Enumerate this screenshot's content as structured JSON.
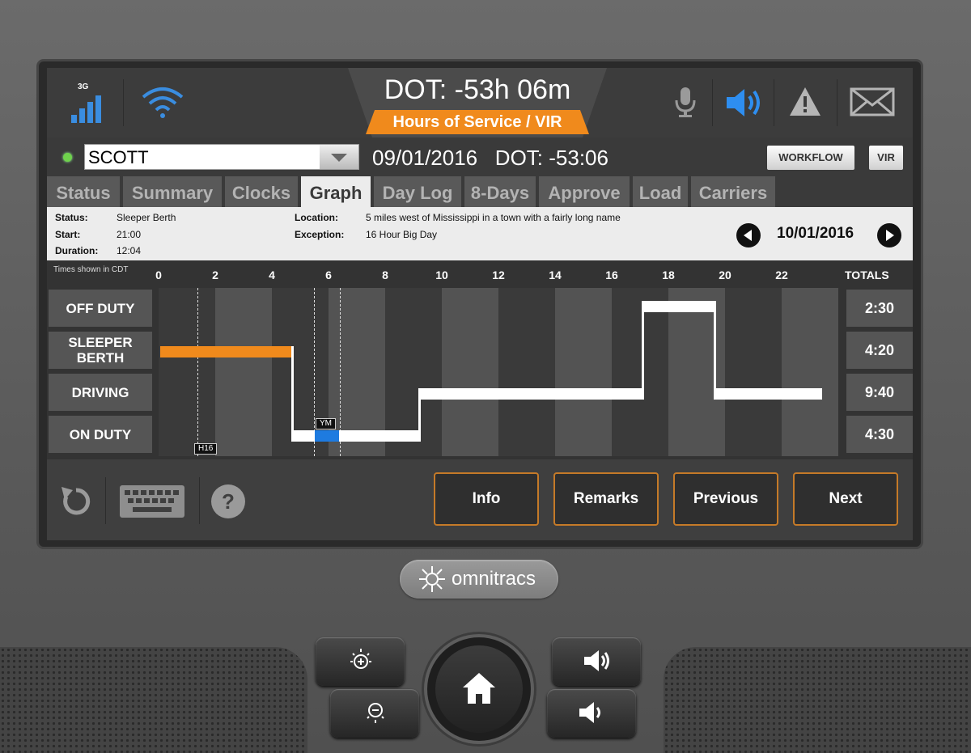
{
  "topbar": {
    "signal_label": "3G",
    "dot_clock": "DOT: -53h 06m",
    "subtitle": "Hours of Service / VIR"
  },
  "driver_row": {
    "driver_name": "SCOTT",
    "date_and_dot": "09/01/2016   DOT: -53:06",
    "workflow_label": "WORKFLOW",
    "vir_label": "VIR"
  },
  "tabs": [
    "Status",
    "Summary",
    "Clocks",
    "Graph",
    "Day Log",
    "8-Days",
    "Approve",
    "Load",
    "Carriers"
  ],
  "active_tab": "Graph",
  "info": {
    "status_key": "Status:",
    "status_val": "Sleeper Berth",
    "start_key": "Start:",
    "start_val": "21:00",
    "duration_key": "Duration:",
    "duration_val": "12:04",
    "location_key": "Location:",
    "location_val": "5 miles west of Mississippi in a town with a fairly long name",
    "exception_key": "Exception:",
    "exception_val": "16 Hour Big Day",
    "nav_date": "10/01/2016"
  },
  "graph": {
    "timezone_note": "Times shown in CDT",
    "hours": [
      "0",
      "2",
      "4",
      "6",
      "8",
      "10",
      "12",
      "14",
      "16",
      "18",
      "20",
      "22"
    ],
    "totals_header": "TOTALS",
    "rows": [
      {
        "label": "OFF DUTY",
        "total": "2:30"
      },
      {
        "label": "SLEEPER BERTH",
        "total": "4:20"
      },
      {
        "label": "DRIVING",
        "total": "9:40"
      },
      {
        "label": "ON DUTY",
        "total": "4:30"
      }
    ],
    "markers": {
      "h16": "H16",
      "ym": "YM"
    },
    "colors": {
      "sleeper": "#f08a1c",
      "ym": "#1e7be0",
      "line": "#ffffff"
    }
  },
  "bottom": {
    "info_label": "Info",
    "remarks_label": "Remarks",
    "previous_label": "Previous",
    "next_label": "Next"
  },
  "hardware": {
    "logo_text": "omnitracs"
  }
}
